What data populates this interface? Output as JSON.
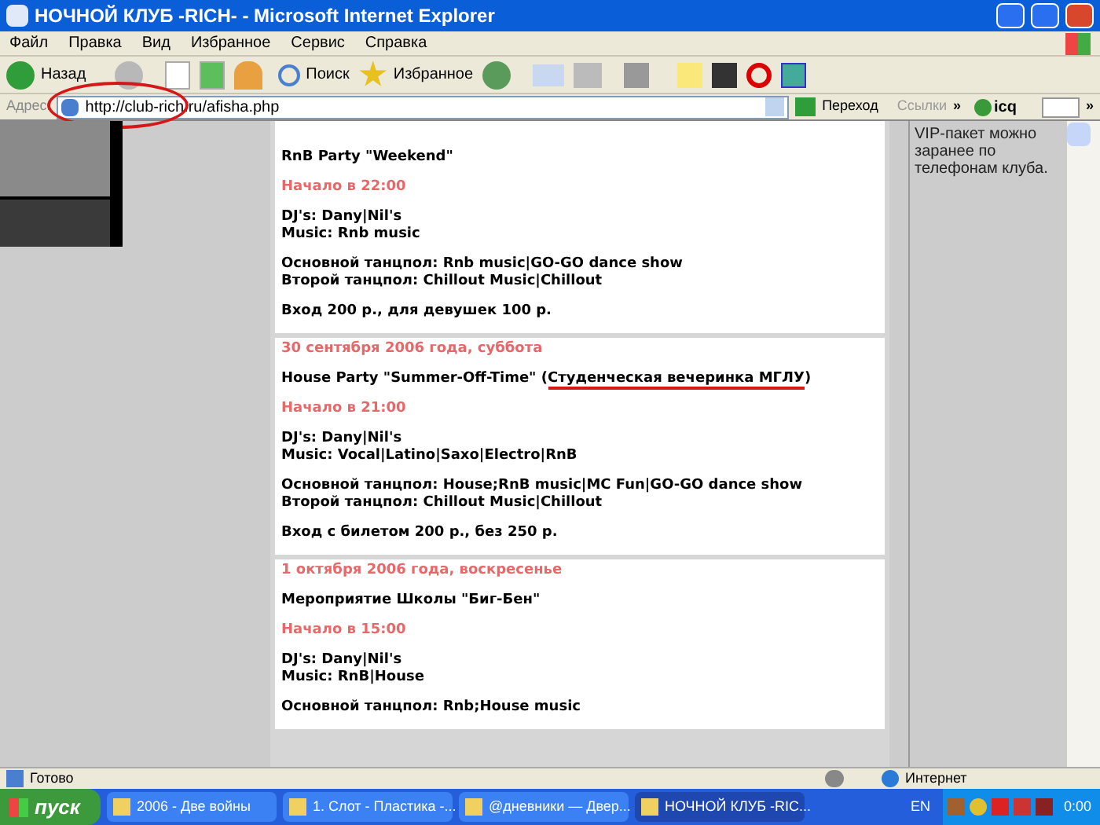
{
  "window": {
    "title": "НОЧНОЙ КЛУБ -RICH- - Microsoft Internet Explorer"
  },
  "menu": [
    "Файл",
    "Правка",
    "Вид",
    "Избранное",
    "Сервис",
    "Справка"
  ],
  "toolbar": {
    "back": "Назад",
    "search": "Поиск",
    "favorites": "Избранное"
  },
  "address_bar": {
    "label": "Адрес:",
    "value": "http://club-rich.ru/afisha.php",
    "go": "Переход",
    "links": "Ссылки",
    "links_more": "»",
    "icq": "icq",
    "more": "»"
  },
  "events": [
    {
      "title": "RnB Party \"Weekend\"",
      "start": "Начало в 22:00",
      "blocks": [
        [
          "DJ's: Dany|Nil's",
          "Music: Rnb music"
        ],
        [
          "Основной танцпол: Rnb music|GO-GO dance show",
          "Второй танцпол: Chillout Music|Chillout"
        ],
        [
          "Вход 200 р., для девушек 100 р."
        ]
      ]
    },
    {
      "date": "30 сентября 2006 года, суббота",
      "title": "House Party \"Summer-Off-Time\" (",
      "note": "Студенческая вечеринка МГЛУ",
      "title_end": ")",
      "start": "Начало в 21:00",
      "blocks": [
        [
          "DJ's: Dany|Nil's",
          "Music: Vocal|Latino|Saxo|Electro|RnB"
        ],
        [
          "Основной танцпол: House;RnB music|MC Fun|GO-GO dance show",
          "Второй танцпол: Chillout Music|Chillout"
        ],
        [
          "Вход с билетом 200 р., без 250 р."
        ]
      ]
    },
    {
      "date": "1 октября 2006 года, воскресенье",
      "title": "Мероприятие Школы \"Биг-Бен\"",
      "start": "Начало в 15:00",
      "blocks": [
        [
          "DJ's: Dany|Nil's",
          "Music: RnB|House"
        ],
        [
          "Основной танцпол: Rnb;House music"
        ]
      ]
    }
  ],
  "right_column": {
    "text": [
      "VIP-пакет можно",
      "заранее по",
      "телефонам клуба."
    ]
  },
  "status_bar": {
    "text": "Готово",
    "zone": "Интернет"
  },
  "taskbar": {
    "start": "пуск",
    "tasks": [
      {
        "label": "2006 - Две войны",
        "selected": false
      },
      {
        "label": "1. Слот - Пластика -...",
        "selected": false
      },
      {
        "label": "@дневники — Двер...",
        "selected": false
      },
      {
        "label": "НОЧНОЙ КЛУБ -RIC...",
        "selected": true
      }
    ],
    "lang": "EN",
    "clock": "0:00"
  }
}
